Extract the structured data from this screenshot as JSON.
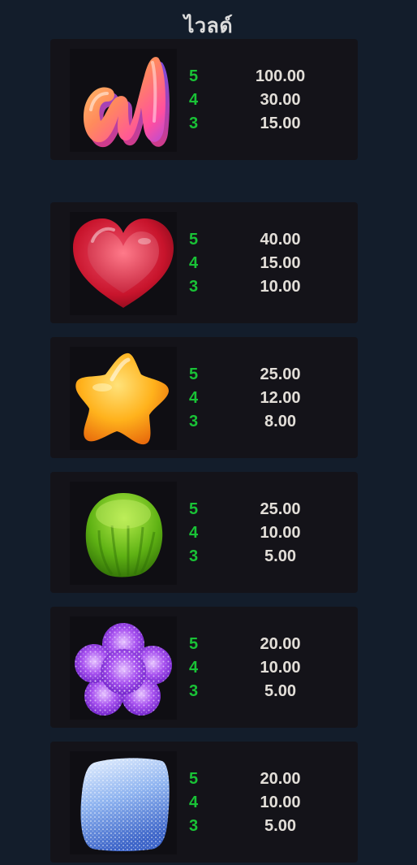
{
  "title": "ไวลด์",
  "symbols": [
    {
      "icon": "wild-w-candy-icon",
      "payouts": [
        {
          "count": "5",
          "value": "100.00"
        },
        {
          "count": "4",
          "value": "30.00"
        },
        {
          "count": "3",
          "value": "15.00"
        }
      ]
    },
    {
      "icon": "heart-candy-icon",
      "payouts": [
        {
          "count": "5",
          "value": "40.00"
        },
        {
          "count": "4",
          "value": "15.00"
        },
        {
          "count": "3",
          "value": "10.00"
        }
      ]
    },
    {
      "icon": "star-candy-icon",
      "payouts": [
        {
          "count": "5",
          "value": "25.00"
        },
        {
          "count": "4",
          "value": "12.00"
        },
        {
          "count": "3",
          "value": "8.00"
        }
      ]
    },
    {
      "icon": "green-gumdrop-icon",
      "payouts": [
        {
          "count": "5",
          "value": "25.00"
        },
        {
          "count": "4",
          "value": "10.00"
        },
        {
          "count": "3",
          "value": "5.00"
        }
      ]
    },
    {
      "icon": "purple-flower-candy-icon",
      "payouts": [
        {
          "count": "5",
          "value": "20.00"
        },
        {
          "count": "4",
          "value": "10.00"
        },
        {
          "count": "3",
          "value": "5.00"
        }
      ]
    },
    {
      "icon": "blue-sugar-cube-icon",
      "payouts": [
        {
          "count": "5",
          "value": "20.00"
        },
        {
          "count": "4",
          "value": "10.00"
        },
        {
          "count": "3",
          "value": "5.00"
        }
      ]
    }
  ],
  "colors": {
    "background": "#131d2b",
    "card": "#141319",
    "count": "#19c236",
    "value": "#e2ded8"
  }
}
